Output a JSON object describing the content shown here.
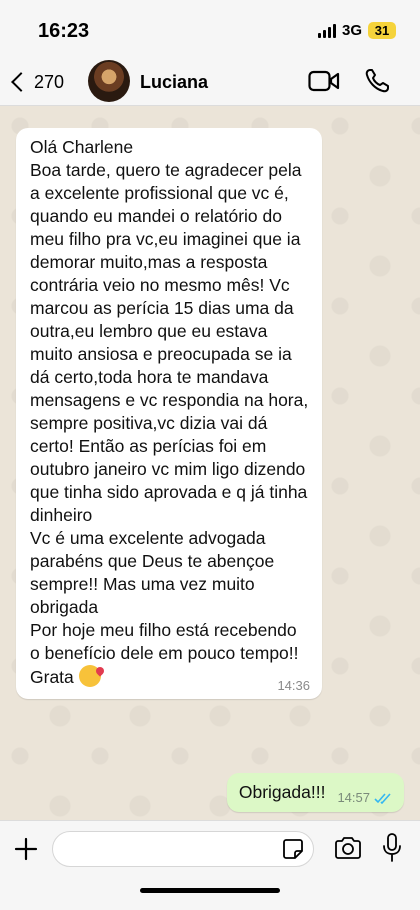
{
  "status_bar": {
    "time": "16:23",
    "network": "3G",
    "battery": "31"
  },
  "header": {
    "back_count": "270",
    "contact_name": "Luciana"
  },
  "messages": {
    "incoming": {
      "text": "Olá Charlene\nBoa tarde, quero te agradecer pela a excelente profissional que vc é, quando eu mandei o relatório do meu filho pra vc,eu imaginei que ia demorar muito,mas a resposta contrária veio no mesmo mês! Vc marcou as perícia 15 dias uma da outra,eu lembro que eu estava muito ansiosa e preocupada se ia dá certo,toda hora te mandava mensagens e vc respondia na hora, sempre positiva,vc dizia vai dá certo! Então as perícias foi em outubro janeiro vc mim ligo dizendo que tinha sido aprovada e q já tinha dinheiro\nVc é uma excelente advogada parabéns que Deus te abençoe sempre!! Mas uma vez muito obrigada\nPor hoje meu filho está recebendo o benefício dele em pouco tempo!! Grata ",
      "time": "14:36",
      "emoji": "face-blowing-kiss"
    },
    "outgoing": {
      "text": "Obrigada!!!",
      "time": "14:57",
      "status": "read"
    }
  },
  "colors": {
    "incoming_bubble": "#ffffff",
    "outgoing_bubble": "#dcf8c6",
    "read_ticks": "#34b7f1",
    "chat_background": "#ebe4d8"
  }
}
